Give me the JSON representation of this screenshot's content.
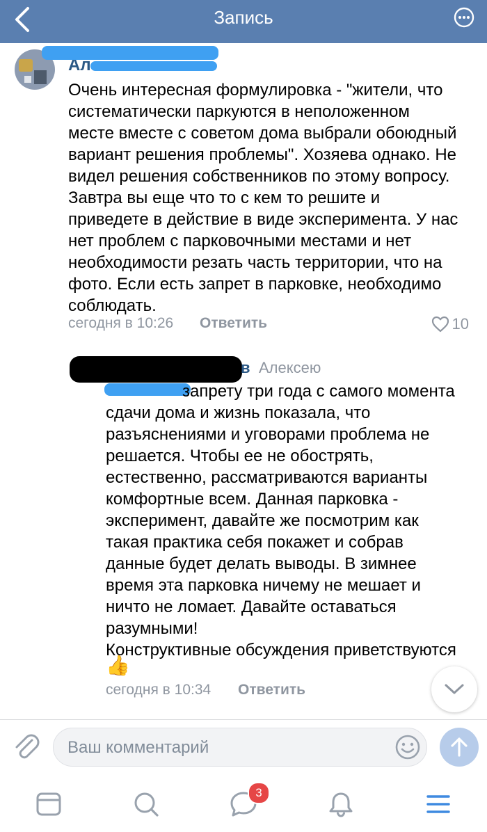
{
  "header": {
    "title": "Запись",
    "back_icon": "chevron-left-icon",
    "more_icon": "more-dots-icon"
  },
  "comments": [
    {
      "author_fragment": "Ал",
      "text": "Очень интересная формулировка - \"жители, что\nсистематически паркуются в неположенном\nместе вместе с советом дома выбрали обоюдный\nвариант решения проблемы\". Хозяева однако. Не\nвидел  решения собственников по этому вопросу.\nЗавтра вы еще что то с кем то решите и\nприведете в действие в виде эксперимента. У нас\nнет проблем с парковочными местами и нет\nнеобходимости резать часть территории, что на\nфото. Если есть запрет в парковке, необходимо\nсоблюдать.",
      "time": "сегодня в 10:26",
      "reply_label": "Ответить",
      "likes": "10"
    },
    {
      "author_fragment": "в",
      "reply_to": "Алексею",
      "text_first_line": "запрету три года с самого момента",
      "text": "сдачи дома и жизнь показала, что\nразъяснениями и уговорами проблема не\nрешается. Чтобы ее не обострять,\nестественно, рассматриваются варианты\nкомфортные всем. Данная парковка -\nэксперимент, давайте же посмотрим как\nтакая практика себя покажет и собрав\nданные будет делать выводы. В зимнее\nвремя эта парковка ничему не мешает и\nничто не ломает. Давайте оставаться\nразумными!\nКонструктивные обсуждения приветствуются",
      "emoji": "👍",
      "time": "сегодня в 10:34",
      "reply_label": "Ответить"
    }
  ],
  "composer": {
    "placeholder": "Ваш комментарий",
    "attach_icon": "paperclip-icon",
    "emoji_icon": "smile-icon",
    "send_icon": "send-arrow-icon"
  },
  "tabbar": {
    "items": [
      "news-icon",
      "search-icon",
      "messages-icon",
      "notifications-icon",
      "menu-icon"
    ],
    "messages_badge": "3"
  },
  "colors": {
    "header": "#5a7fb0",
    "link": "#2a5885",
    "meta": "#8f96a0",
    "accent": "#3f8ae0",
    "badge": "#e64646"
  }
}
